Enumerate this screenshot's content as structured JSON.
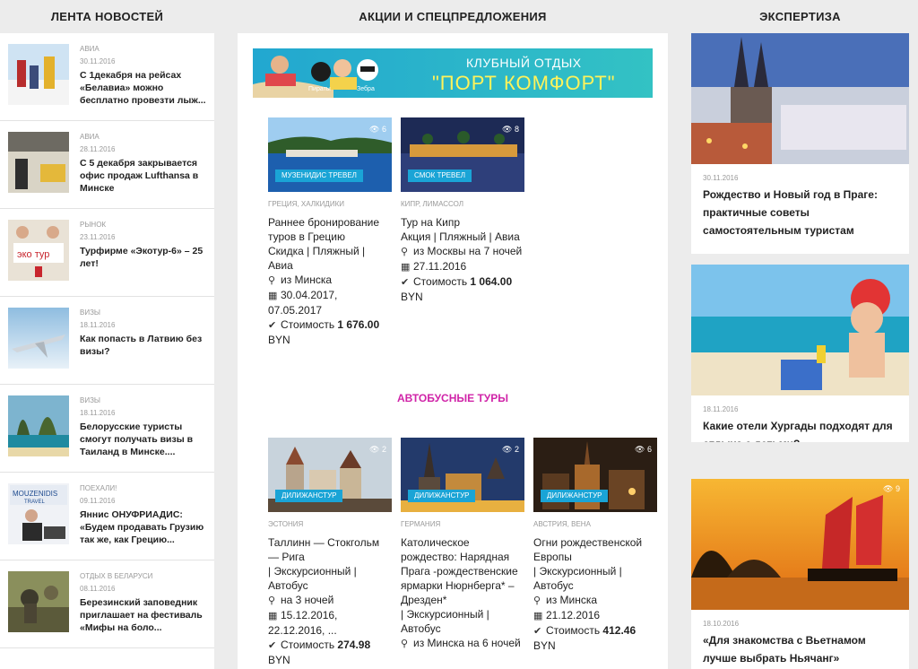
{
  "headers": {
    "news": "ЛЕНТА НОВОСТЕЙ",
    "offers": "АКЦИИ И СПЕЦПРЕДЛОЖЕНИЯ",
    "expertise": "ЭКСПЕРТИЗА"
  },
  "news": [
    {
      "category": "АВИА",
      "date": "30.11.2016",
      "title": "С 1декабря на рейсах «Белавиа» можно бесплатно провезти лыж..."
    },
    {
      "category": "АВИА",
      "date": "28.11.2016",
      "title": "С 5 декабря закрывается офис продаж Lufthansa в Минске"
    },
    {
      "category": "РЫНОК",
      "date": "23.11.2016",
      "title": "Турфирме «Экотур-6» – 25 лет!"
    },
    {
      "category": "ВИЗЫ",
      "date": "18.11.2016",
      "title": "Как попасть в Латвию без визы?"
    },
    {
      "category": "ВИЗЫ",
      "date": "18.11.2016",
      "title": "Белорусские туристы смогут получать визы в Таиланд в Минске...."
    },
    {
      "category": "ПОЕХАЛИ!",
      "date": "09.11.2016",
      "title": "Яннис ОНУФРИАДИС: «Будем продавать Грузию так же, как Грецию..."
    },
    {
      "category": "ОТДЫХ В БЕЛАРУСИ",
      "date": "08.11.2016",
      "title": "Березинский заповедник приглашает на фестиваль «Мифы на боло..."
    }
  ],
  "banner": {
    "line1": "КЛУБНЫЙ ОТДЫХ",
    "line2": "\"ПОРТ КОМФОРТ\"",
    "logo1": "Пираты",
    "logo2": "Зебра"
  },
  "tours_top": [
    {
      "tag": "МУЗЕНИДИС ТРЕВЕЛ",
      "views": "6",
      "region": "ГРЕЦИЯ, ХАЛКИДИКИ",
      "title": "Раннее бронирование туров в Грецию",
      "type": "Скидка | Пляжный | Авиа",
      "from": "из Минска",
      "dates": "30.04.2017, 07.05.2017",
      "price_label": "Стоимость",
      "price": "1 676.00",
      "currency": "BYN"
    },
    {
      "tag": "СМОК ТРЕВЕЛ",
      "views": "8",
      "region": "КИПР, ЛИМАССОЛ",
      "title": "Тур на Кипр",
      "type": "Акция | Пляжный | Авиа",
      "from": "из Москвы на 7 ночей",
      "dates": "27.11.2016",
      "price_label": "Стоимость",
      "price": "1 064.00",
      "currency": "BYN"
    }
  ],
  "bus_section_title": "АВТОБУСНЫЕ ТУРЫ",
  "tours_bus": [
    {
      "tag": "ДИЛИЖАНСТУР",
      "views": "2",
      "region": "ЭСТОНИЯ",
      "title": "Таллинн — Стокгольм — Рига",
      "type": "| Экскурсионный | Автобус",
      "from": "на 3 ночей",
      "dates": "15.12.2016, 22.12.2016, ...",
      "price_label": "Стоимость",
      "price": "274.98",
      "currency": "BYN"
    },
    {
      "tag": "ДИЛИЖАНСТУР",
      "views": "2",
      "region": "ГЕРМАНИЯ",
      "title": "Католическое рождество: Нарядная Прага -рождественские ярмарки Нюрнберга* – Дрезден*",
      "type": "| Экскурсионный | Автобус",
      "from": "из Минска на 6 ночей",
      "dates": "",
      "price_label": "",
      "price": "",
      "currency": ""
    },
    {
      "tag": "ДИЛИЖАНСТУР",
      "views": "6",
      "region": "АВСТРИЯ, ВЕНА",
      "title": "Огни рождественской Европы",
      "type": "| Экскурсионный | Автобус",
      "from": "из Минска",
      "dates": "21.12.2016",
      "price_label": "Стоимость",
      "price": "412.46",
      "currency": "BYN"
    }
  ],
  "expertise": [
    {
      "date": "30.11.2016",
      "title": "Рождество и Новый год в Праге: практичные советы самостоятельным туристам",
      "views": ""
    },
    {
      "date": "18.11.2016",
      "title": "Какие отели Хургады подходят для отдыха с детьми?",
      "views": ""
    },
    {
      "date": "18.10.2016",
      "title": "«Для знакомства с Вьетнамом лучше выбрать Ньячанг»",
      "views": "9"
    }
  ]
}
